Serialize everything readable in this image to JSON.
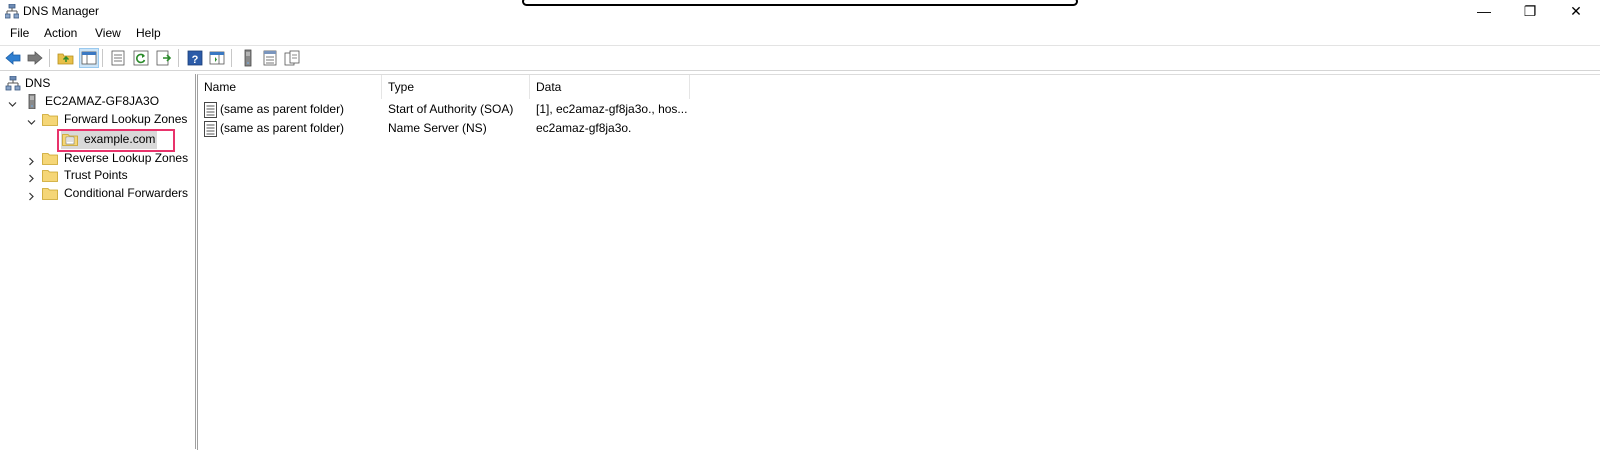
{
  "window": {
    "title": "DNS Manager",
    "controls": {
      "minimize": "—",
      "maximize": "❐",
      "close": "✕"
    }
  },
  "menu": [
    "File",
    "Action",
    "View",
    "Help"
  ],
  "toolbar": {
    "icons": [
      "back-icon",
      "forward-icon",
      "up-folder-icon",
      "show-hide-tree-icon",
      "properties-icon",
      "refresh-icon",
      "export-list-icon",
      "help-icon",
      "show-hide-action-pane-icon",
      "server-icon",
      "list-view-icon",
      "copy-icon"
    ]
  },
  "tree": {
    "root": "DNS",
    "server": "EC2AMAZ-GF8JA3O",
    "forward_zones": "Forward Lookup Zones",
    "zone": "example.com",
    "reverse_zones": "Reverse Lookup Zones",
    "trust_points": "Trust Points",
    "conditional_forwarders": "Conditional Forwarders"
  },
  "list": {
    "columns": [
      "Name",
      "Type",
      "Data"
    ],
    "rows": [
      {
        "name": "(same as parent folder)",
        "type": "Start of Authority (SOA)",
        "data": "[1], ec2amaz-gf8ja3o., hos..."
      },
      {
        "name": "(same as parent folder)",
        "type": "Name Server (NS)",
        "data": "ec2amaz-gf8ja3o."
      }
    ]
  },
  "colors": {
    "selection_outline": "#e8336b",
    "selection_fill": "#d9d9d9"
  }
}
